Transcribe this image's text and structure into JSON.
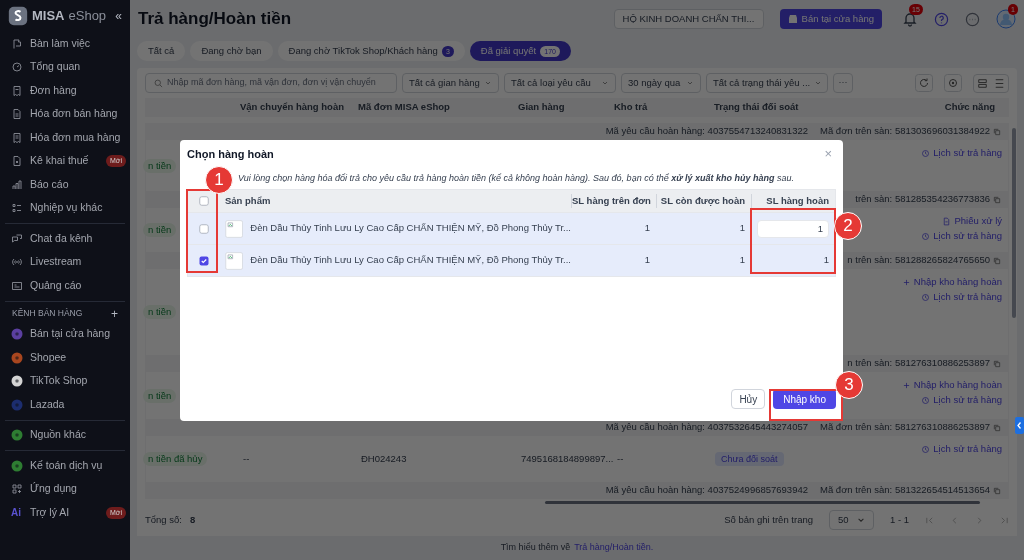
{
  "sidebar": {
    "logo": "MISA",
    "logo_suffix": "eShop",
    "collapse_glyph": "«",
    "sections": [
      {
        "items": [
          {
            "label": "Bàn làm việc"
          },
          {
            "label": "Tổng quan"
          },
          {
            "label": "Đơn hàng"
          },
          {
            "label": "Hóa đơn bán hàng"
          },
          {
            "label": "Hóa đơn mua hàng"
          },
          {
            "label": "Kê khai thuế",
            "badge": "Mới"
          },
          {
            "label": "Báo cáo"
          },
          {
            "label": "Nghiệp vụ khác"
          }
        ]
      },
      {
        "items": [
          {
            "label": "Chat đa kênh"
          },
          {
            "label": "Livestream"
          },
          {
            "label": "Quảng cáo"
          }
        ]
      },
      {
        "heading": "KÊNH BÁN HÀNG",
        "add_glyph": "+",
        "items": [
          {
            "label": "Bán tại cửa hàng",
            "color": "#5b3fa0"
          },
          {
            "label": "Shopee",
            "color": "#a8461f"
          },
          {
            "label": "TikTok Shop",
            "color": "#d4d4d4"
          },
          {
            "label": "Lazada",
            "color": "#1c2d6e"
          }
        ]
      },
      {
        "items": [
          {
            "label": "Nguồn khác",
            "color": "#2e7d32"
          }
        ]
      },
      {
        "items": [
          {
            "label": "Kế toán dịch vụ",
            "color": "#2e7d32"
          },
          {
            "label": "Ứng dụng"
          },
          {
            "label": "Trợ lý AI",
            "icon_text": "Ai",
            "badge": "Mới"
          }
        ]
      }
    ]
  },
  "header": {
    "title": "Trả hàng/Hoàn tiền",
    "shop_select": "HỘ KINH DOANH CHẤN THI...",
    "store_button": "Bán tại cửa hàng",
    "notification_count": "15",
    "avatar_badge": "1"
  },
  "tabs": [
    {
      "label": "Tất cả",
      "selected": false
    },
    {
      "label": "Đang chờ bạn",
      "selected": false
    },
    {
      "label": "Đang chờ TikTok Shop/Khách hàng",
      "count": "3",
      "selected": false
    },
    {
      "label": "Đã giải quyết",
      "count": "170",
      "selected": true
    }
  ],
  "filters": {
    "search_placeholder": "Nhập mã đơn hàng, mã vận đơn, đơn vị vận chuyển",
    "dropdowns": [
      "Tất cả gian hàng",
      "Tất cả loại yêu cầu",
      "30 ngày qua",
      "Tất cả trạng thái yêu ..."
    ],
    "more": "···"
  },
  "table": {
    "columns": [
      "Vận chuyển hàng hoàn",
      "Mã đơn MISA eShop",
      "Gian hàng",
      "Kho trả",
      "Trạng thái đối soát",
      "Chức năng"
    ],
    "groups": [
      {
        "request_label": "Mã yêu cầu hoàn hàng: 4037554713240831322",
        "platform_label": "Mã đơn trên sàn: 581303696031384922",
        "status": "n tiền",
        "actions": [
          {
            "kind": "history",
            "label": "Lịch sử trả hàng"
          }
        ]
      },
      {
        "platform_label": "trên sàn: 581285354236773836",
        "status": "n tiền",
        "actions": [
          {
            "kind": "process",
            "label": "Phiếu xử lý"
          },
          {
            "kind": "history",
            "label": "Lịch sử trả hàng"
          }
        ]
      },
      {
        "platform_label": "n trên sàn: 581288265824765650",
        "status": "n tiền",
        "actions": [
          {
            "kind": "import",
            "label": "Nhập kho hàng hoàn"
          },
          {
            "kind": "history",
            "label": "Lịch sử trả hàng"
          }
        ]
      },
      {
        "platform_label": "n trên sàn: 581276310886253897",
        "status": "n tiền",
        "actions": [
          {
            "kind": "import",
            "label": "Nhập kho hàng hoàn"
          },
          {
            "kind": "history",
            "label": "Lịch sử trả hàng"
          }
        ]
      },
      {
        "request_label": "Mã yêu cầu hoàn hàng: 4037532645443274057",
        "platform_label": "Mã đơn trên sàn: 581276310886253897",
        "status": "n tiền đã hủy",
        "cells": [
          "--",
          "ĐH024243",
          "7495168184899897...",
          "--"
        ],
        "reconciliation": "Chưa đối soát",
        "actions": [
          {
            "kind": "history",
            "label": "Lịch sử trả hàng"
          }
        ]
      },
      {
        "request_label": "Mã yêu cầu hoàn hàng: 4037524996857693942",
        "platform_label": "Mã đơn trên sàn: 581322654514513654"
      }
    ]
  },
  "footer": {
    "total_label": "Tổng số:",
    "total": "8",
    "page_size_label": "Số bản ghi trên trang",
    "page_size": "50",
    "range": "1 - 1"
  },
  "help": {
    "text": "Tìm hiểu thêm về",
    "link": "Trả hàng/Hoàn tiền."
  },
  "modal": {
    "title": "Chọn hàng hoàn",
    "close": "×",
    "description": "Vui lòng chọn hàng hóa đổi trả cho yêu cầu trả hàng hoàn tiền (kể cả không hoàn hàng). Sau đó, bạn có thể **xử lý xuất kho hủy hàng** sau.",
    "columns": [
      "Sản phẩm",
      "SL hàng trên đơn",
      "SL còn được hoàn",
      "SL hàng hoàn"
    ],
    "select_all_checked": false,
    "rows": [
      {
        "checked": false,
        "product": "Đèn Dầu Thủy Tinh Lưu Ly Cao Cấp CHẤN THIỆN MỸ, Đồ Phong Thủy Tr...",
        "ordered": "1",
        "remaining": "1",
        "return_qty": "1",
        "editable": true
      },
      {
        "checked": true,
        "product": "Đèn Dầu Thủy Tinh Lưu Ly Cao Cấp CHẤN THIỆN MỸ, Đồ Phong Thủy Tr...",
        "ordered": "1",
        "remaining": "1",
        "return_qty": "1",
        "editable": false
      }
    ],
    "buttons": [
      {
        "kind": "secondary",
        "label": "Hủy"
      },
      {
        "kind": "primary",
        "label": "Nhập kho"
      }
    ]
  },
  "annotations": [
    {
      "number": "1"
    },
    {
      "number": "2"
    },
    {
      "number": "3"
    }
  ]
}
